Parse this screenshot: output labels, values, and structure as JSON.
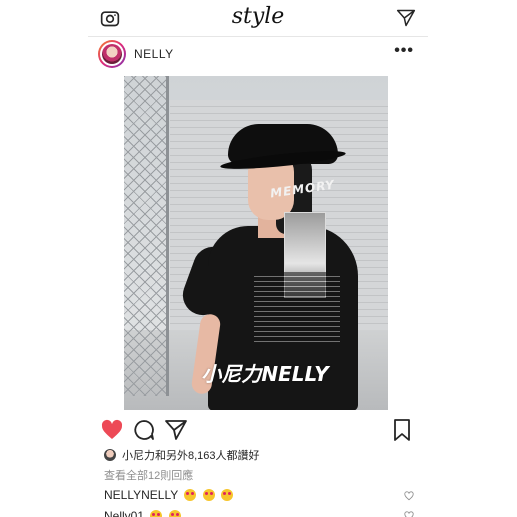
{
  "app": {
    "title": "style"
  },
  "header": {
    "camera_icon": "camera-icon",
    "direct_icon": "paper-plane-icon"
  },
  "post": {
    "username": "NELLY",
    "more_label": "•••",
    "image": {
      "description_icon": "photo",
      "watermark": "小尼力NELLY",
      "shirt_print": "MEMORY"
    },
    "actions": {
      "like_icon": "heart-filled-icon",
      "comment_icon": "comment-icon",
      "share_icon": "paper-plane-icon",
      "save_icon": "bookmark-icon",
      "like_color": "#ed4956"
    },
    "likes_text": "小尼力和另外8,163人都讚好",
    "view_all_comments": "查看全部12則回應",
    "comments": [
      {
        "user": "NELLYNELLY",
        "emojis": 3
      },
      {
        "user": "Nelly01",
        "emojis": 2
      }
    ]
  }
}
